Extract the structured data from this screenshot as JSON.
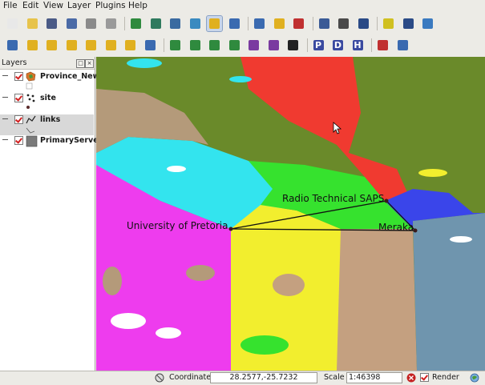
{
  "menu": [
    {
      "label": "File",
      "accel": "F"
    },
    {
      "label": "Edit",
      "accel": "E"
    },
    {
      "label": "View",
      "accel": "V"
    },
    {
      "label": "Layer",
      "accel": "L"
    },
    {
      "label": "Plugins",
      "accel": "P"
    },
    {
      "label": "Help",
      "accel": "H"
    }
  ],
  "toolbar_row1": [
    {
      "name": "new-project-icon",
      "color": "#e8e8e8"
    },
    {
      "name": "open-project-icon",
      "color": "#e7c34a"
    },
    {
      "name": "save-project-icon",
      "color": "#4a5a86"
    },
    {
      "name": "save-as-icon",
      "color": "#4a6aa6"
    },
    {
      "name": "print-composer-icon",
      "color": "#8a8a8a"
    },
    {
      "name": "print-icon",
      "color": "#9a9a9a"
    },
    {
      "name": "add-vector-icon",
      "color": "#2f8a3e"
    },
    {
      "name": "add-raster-icon",
      "color": "#2f7a5e"
    },
    {
      "name": "add-postgis-icon",
      "color": "#3a6aa0"
    },
    {
      "name": "add-wms-icon",
      "color": "#3a8ac0"
    },
    {
      "name": "overview-icon",
      "color": "#e0b020",
      "active": true
    },
    {
      "name": "remove-layer-icon",
      "color": "#3a6ab0"
    },
    {
      "name": "identify-icon",
      "color": "#3a6ab0"
    },
    {
      "name": "select-icon",
      "color": "#e0b020"
    },
    {
      "name": "deselect-icon",
      "color": "#c03030"
    },
    {
      "name": "attribute-table-icon",
      "color": "#3a5a96"
    },
    {
      "name": "measure-line-icon",
      "color": "#4a4a4a"
    },
    {
      "name": "measure-area-icon",
      "color": "#2a4a86"
    },
    {
      "name": "map-tips-icon",
      "color": "#d0c020"
    },
    {
      "name": "home-icon",
      "color": "#2a4a86"
    },
    {
      "name": "grass-icon",
      "color": "#3a7ac0"
    }
  ],
  "toolbar_row2": [
    {
      "name": "pan-icon",
      "color": "#3a6ab0"
    },
    {
      "name": "zoom-in-icon",
      "color": "#e0b020"
    },
    {
      "name": "zoom-out-icon",
      "color": "#e0b020"
    },
    {
      "name": "zoom-full-icon",
      "color": "#e0b020"
    },
    {
      "name": "zoom-selection-icon",
      "color": "#e0b020"
    },
    {
      "name": "zoom-layer-icon",
      "color": "#e0b020"
    },
    {
      "name": "zoom-last-icon",
      "color": "#e0b020"
    },
    {
      "name": "refresh-icon",
      "color": "#3a6ab0"
    },
    {
      "name": "digitize-point-icon",
      "color": "#2f8a3e"
    },
    {
      "name": "digitize-line-icon",
      "color": "#2f8a3e"
    },
    {
      "name": "digitize-polygon-icon",
      "color": "#2f8a3e"
    },
    {
      "name": "move-feature-icon",
      "color": "#2f8a3e"
    },
    {
      "name": "split-feature-icon",
      "color": "#7a3aa0"
    },
    {
      "name": "delete-feature-icon",
      "color": "#7a3aa0"
    },
    {
      "name": "plugin-icon",
      "color": "#222222"
    },
    {
      "name": "p-icon",
      "color": "#3a4aa0",
      "letter": "P"
    },
    {
      "name": "d-icon",
      "color": "#3a4aa0",
      "letter": "D"
    },
    {
      "name": "h-icon",
      "color": "#3a4aa0",
      "letter": "H"
    },
    {
      "name": "pdf-icon",
      "color": "#c03030"
    },
    {
      "name": "help-icon",
      "color": "#3a6ab0"
    }
  ],
  "layers_panel": {
    "title": "Layers",
    "items": [
      {
        "name": "Province_New",
        "icon": "polygon-layer-icon"
      },
      {
        "name": "site",
        "icon": "point-layer-icon"
      },
      {
        "name": "links",
        "icon": "line-layer-icon",
        "selected": true
      },
      {
        "name": "PrimaryServer",
        "icon": "raster-layer-icon"
      }
    ]
  },
  "map": {
    "labels": [
      {
        "text": "Radio Technical SAPS"
      },
      {
        "text": "University of Pretoria"
      },
      {
        "text": "Meraka"
      }
    ]
  },
  "status": {
    "coord_label": "Coordinate:",
    "coord_value": "28.2577,-25.7232",
    "scale_label": "Scale",
    "scale_value": "1:46398",
    "render_label": "Render"
  }
}
